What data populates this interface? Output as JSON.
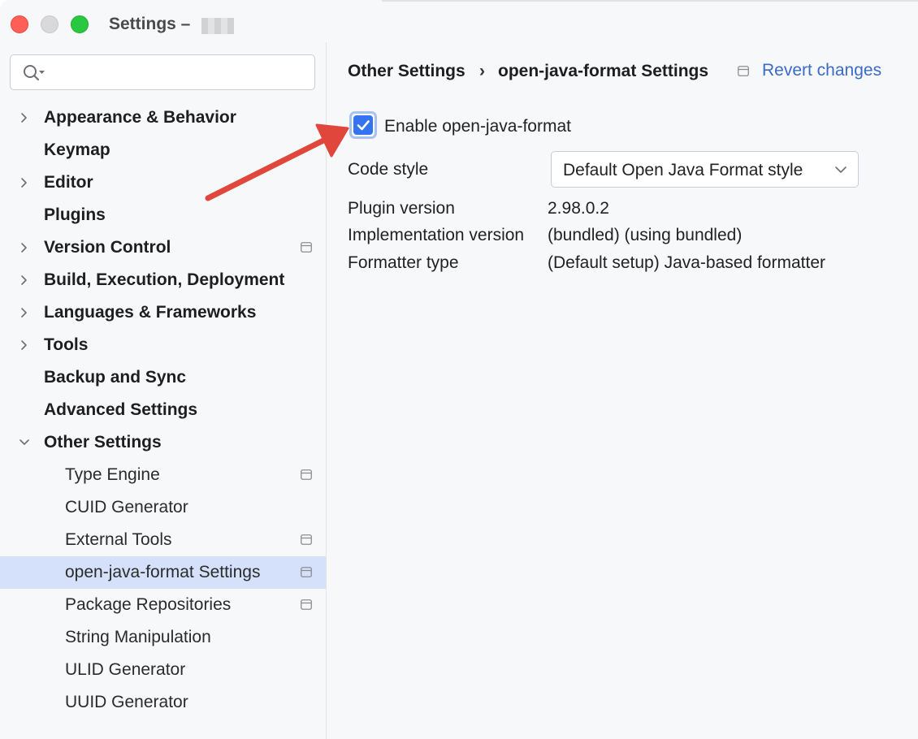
{
  "window": {
    "title": "Settings –",
    "title_suffix_obscured": true
  },
  "sidebar": {
    "search": {
      "placeholder": "",
      "value": ""
    },
    "items": [
      {
        "label": "Appearance & Behavior",
        "level": "top",
        "expandable": true,
        "expanded": false,
        "has_doc_icon": false
      },
      {
        "label": "Keymap",
        "level": "top",
        "expandable": false,
        "has_doc_icon": false
      },
      {
        "label": "Editor",
        "level": "top",
        "expandable": true,
        "expanded": false,
        "has_doc_icon": false
      },
      {
        "label": "Plugins",
        "level": "top",
        "expandable": false,
        "has_doc_icon": false
      },
      {
        "label": "Version Control",
        "level": "top",
        "expandable": true,
        "expanded": false,
        "has_doc_icon": true
      },
      {
        "label": "Build, Execution, Deployment",
        "level": "top",
        "expandable": true,
        "expanded": false,
        "has_doc_icon": false
      },
      {
        "label": "Languages & Frameworks",
        "level": "top",
        "expandable": true,
        "expanded": false,
        "has_doc_icon": false
      },
      {
        "label": "Tools",
        "level": "top",
        "expandable": true,
        "expanded": false,
        "has_doc_icon": false
      },
      {
        "label": "Backup and Sync",
        "level": "top",
        "expandable": false,
        "has_doc_icon": false
      },
      {
        "label": "Advanced Settings",
        "level": "top",
        "expandable": false,
        "has_doc_icon": false
      },
      {
        "label": "Other Settings",
        "level": "top",
        "expandable": true,
        "expanded": true,
        "has_doc_icon": false
      },
      {
        "label": "Type Engine",
        "level": "sub",
        "has_doc_icon": true
      },
      {
        "label": "CUID Generator",
        "level": "sub",
        "has_doc_icon": false
      },
      {
        "label": "External Tools",
        "level": "sub",
        "has_doc_icon": true
      },
      {
        "label": "open-java-format Settings",
        "level": "sub",
        "has_doc_icon": true,
        "selected": true
      },
      {
        "label": "Package Repositories",
        "level": "sub",
        "has_doc_icon": true
      },
      {
        "label": "String Manipulation",
        "level": "sub",
        "has_doc_icon": false
      },
      {
        "label": "ULID Generator",
        "level": "sub",
        "has_doc_icon": false
      },
      {
        "label": "UUID Generator",
        "level": "sub",
        "has_doc_icon": false
      }
    ]
  },
  "main": {
    "breadcrumb": [
      "Other Settings",
      "open-java-format Settings"
    ],
    "breadcrumb_separator": "›",
    "revert_label": "Revert changes",
    "enable": {
      "label": "Enable open-java-format",
      "checked": true
    },
    "code_style": {
      "label": "Code style",
      "selected": "Default Open Java Format style"
    },
    "plugin_version": {
      "label": "Plugin version",
      "value": "2.98.0.2"
    },
    "implementation_version": {
      "label": "Implementation version",
      "value": "(bundled) (using bundled)"
    },
    "formatter_type": {
      "label": "Formatter type",
      "value": "(Default setup) Java-based formatter"
    }
  },
  "colors": {
    "accent": "#3574f0",
    "link": "#3a6bc6",
    "selection": "#d5e1fb",
    "annotation_arrow": "#e0463b",
    "close": "#ff5f57",
    "maximize": "#2ac840"
  }
}
